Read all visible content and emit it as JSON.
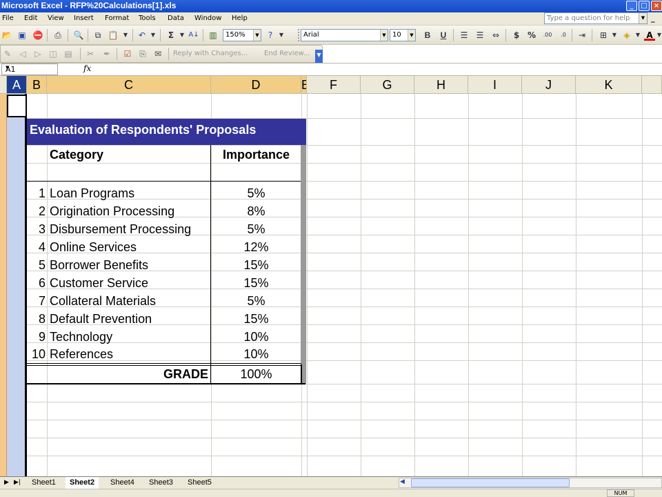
{
  "window": {
    "title": "Microsoft Excel - RFP%20Calculations[1].xls"
  },
  "menu": [
    "File",
    "Edit",
    "View",
    "Insert",
    "Format",
    "Tools",
    "Data",
    "Window",
    "Help"
  ],
  "ask_box": {
    "placeholder": "Type a question for help"
  },
  "toolbar": {
    "zoom": "150%",
    "font_name": "Arial",
    "font_size": "10",
    "bold": "B",
    "underline": "U",
    "currency": "$",
    "percent": "%",
    "reply_with_changes": "Reply with Changes...",
    "end_review": "End Review..."
  },
  "formula_bar": {
    "name_box": "A1",
    "fx": "fx"
  },
  "columns": [
    "A",
    "B",
    "C",
    "D",
    "E",
    "F",
    "G",
    "H",
    "I",
    "J",
    "K"
  ],
  "table": {
    "title": "Evaluation of Respondents' Proposals",
    "headers": {
      "category": "Category",
      "importance": "Importance"
    },
    "rows": [
      {
        "num": "1",
        "category": "Loan Programs",
        "importance": "5%"
      },
      {
        "num": "2",
        "category": "Origination Processing",
        "importance": "8%"
      },
      {
        "num": "3",
        "category": "Disbursement Processing",
        "importance": "5%"
      },
      {
        "num": "4",
        "category": "Online Services",
        "importance": "12%"
      },
      {
        "num": "5",
        "category": "Borrower Benefits",
        "importance": "15%"
      },
      {
        "num": "6",
        "category": "Customer Service",
        "importance": "15%"
      },
      {
        "num": "7",
        "category": "Collateral Materials",
        "importance": "5%"
      },
      {
        "num": "8",
        "category": "Default Prevention",
        "importance": "15%"
      },
      {
        "num": "9",
        "category": "Technology",
        "importance": "10%"
      },
      {
        "num": "10",
        "category": "References",
        "importance": "10%"
      }
    ],
    "total": {
      "label": "GRADE",
      "importance": "100%"
    }
  },
  "sheets": [
    {
      "name": "Sheet1",
      "active": false
    },
    {
      "name": "Sheet2",
      "active": true
    },
    {
      "name": "Sheet4",
      "active": false
    },
    {
      "name": "Sheet3",
      "active": false
    },
    {
      "name": "Sheet5",
      "active": false
    }
  ],
  "status": {
    "num_lock": "NUM"
  }
}
